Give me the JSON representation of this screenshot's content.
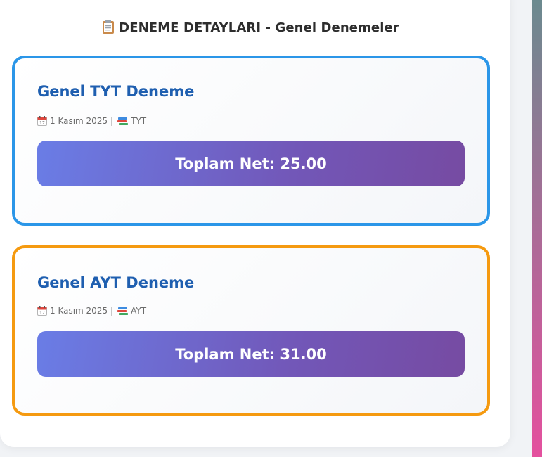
{
  "header": {
    "icon": "clipboard-icon",
    "title": "DENEME DETAYLARI - Genel Denemeler"
  },
  "cards": [
    {
      "title": "Genel TYT Deneme",
      "date_icon": "calendar-icon",
      "date": "1 Kasım 2025",
      "separator": "|",
      "type_icon": "books-icon",
      "type": "TYT",
      "net_label": "Toplam Net: 25.00",
      "border_color": "#2b96e8"
    },
    {
      "title": "Genel AYT Deneme",
      "date_icon": "calendar-icon",
      "date": "1 Kasım 2025",
      "separator": "|",
      "type_icon": "books-icon",
      "type": "AYT",
      "net_label": "Toplam Net: 31.00",
      "border_color": "#f59a10"
    }
  ],
  "colors": {
    "net_gradient_start": "#6a7de6",
    "net_gradient_end": "#764ba2",
    "title_color": "#1f5fb0"
  }
}
